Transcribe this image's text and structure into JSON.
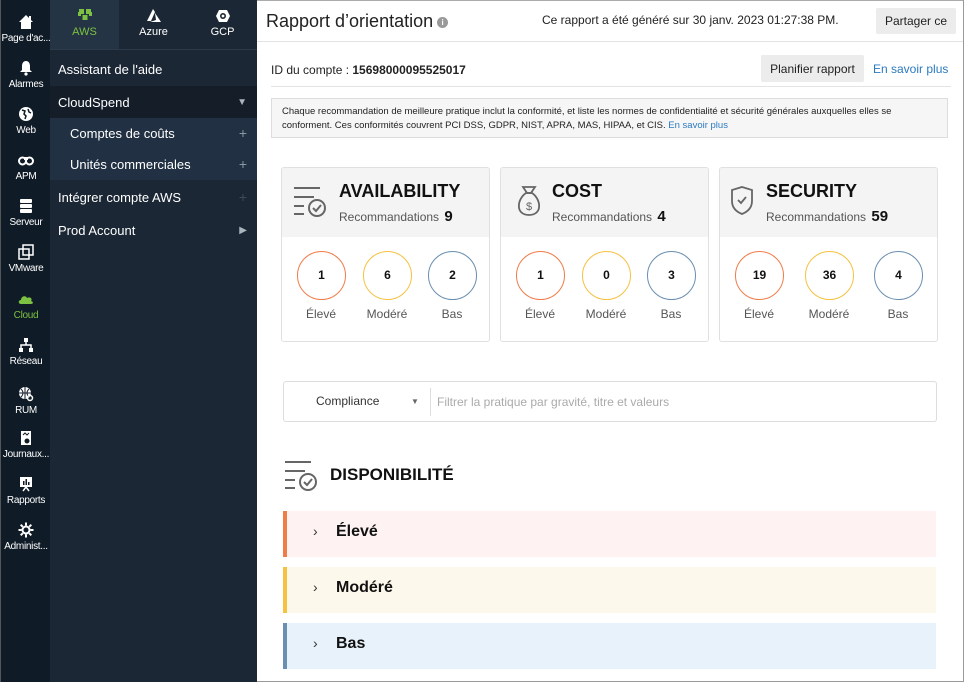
{
  "rail": {
    "items": [
      {
        "label": "Page d'ac...",
        "icon": "home-icon"
      },
      {
        "label": "Alarmes",
        "icon": "bell-icon"
      },
      {
        "label": "Web",
        "icon": "globe-icon"
      },
      {
        "label": "APM",
        "icon": "binoculars-icon"
      },
      {
        "label": "Serveur",
        "icon": "server-icon"
      },
      {
        "label": "VMware",
        "icon": "vmware-icon"
      },
      {
        "label": "Cloud",
        "icon": "cloud-icon"
      },
      {
        "label": "Réseau",
        "icon": "network-icon"
      },
      {
        "label": "RUM",
        "icon": "rum-icon"
      },
      {
        "label": "Journaux...",
        "icon": "logs-icon"
      },
      {
        "label": "Rapports",
        "icon": "reports-icon"
      },
      {
        "label": "Administ...",
        "icon": "gear-icon"
      }
    ],
    "active": "Cloud",
    "active_color": "#7cc142"
  },
  "nav": {
    "tabs": [
      {
        "label": "AWS",
        "icon": "aws-icon"
      },
      {
        "label": "Azure",
        "icon": "azure-icon"
      },
      {
        "label": "GCP",
        "icon": "gcp-icon"
      }
    ],
    "active_tab": "AWS",
    "items": [
      {
        "label": "Assistant de l'aide"
      },
      {
        "label": "CloudSpend",
        "indicator": "▼"
      },
      {
        "label": "Comptes de coûts",
        "indicator": "+"
      },
      {
        "label": "Unités commerciales",
        "indicator": "+"
      },
      {
        "label": "Intégrer compte AWS",
        "indicator": "+"
      },
      {
        "label": "Prod Account",
        "indicator": "▶"
      }
    ]
  },
  "header": {
    "title": "Rapport d’orientation",
    "info": "i",
    "generated": "Ce rapport a été généré sur 30 janv. 2023 01:27:38 PM.",
    "share_label": "Partager ce"
  },
  "account": {
    "label": "ID du compte : ",
    "id": "15698000095525017",
    "schedule_label": "Planifier rapport",
    "learn_more": "En savoir plus"
  },
  "notice": {
    "text": "Chaque recommandation de meilleure pratique inclut la conformité, et liste les normes de confidentialité et sécurité générales auxquelles elles se conforment. Ces conformités couvrent PCI DSS, GDPR, NIST, APRA, MAS, HIPAA, et CIS. ",
    "link": "En savoir plus"
  },
  "cards": [
    {
      "title": "AVAILABILITY",
      "rec_label": "Recommandations",
      "total": "9",
      "high": "1",
      "moderate": "6",
      "low": "2",
      "icon": "availability-icon"
    },
    {
      "title": "COST",
      "rec_label": "Recommandations",
      "total": "4",
      "high": "1",
      "moderate": "0",
      "low": "3",
      "icon": "money-bag-icon"
    },
    {
      "title": "SECURITY",
      "rec_label": "Recommandations",
      "total": "59",
      "high": "19",
      "moderate": "36",
      "low": "4",
      "icon": "shield-check-icon"
    }
  ],
  "severity_labels": {
    "high": "Élevé",
    "moderate": "Modéré",
    "low": "Bas"
  },
  "colors": {
    "high": "#f07c4a",
    "moderate": "#f5c242",
    "low": "#6b8fb0",
    "link": "#2a7ac0"
  },
  "filter": {
    "select_value": "Compliance",
    "placeholder": "Filtrer la pratique par gravité, titre et valeurs"
  },
  "section": {
    "title": "DISPONIBILITÉ",
    "groups": [
      {
        "label": "Élevé",
        "bg": "#fef3f2",
        "bar": "#f07c4a"
      },
      {
        "label": "Modéré",
        "bg": "#fdf8ec",
        "bar": "#f5c242"
      },
      {
        "label": "Bas",
        "bg": "#e8f2fb",
        "bar": "#6b8fb0"
      }
    ]
  }
}
